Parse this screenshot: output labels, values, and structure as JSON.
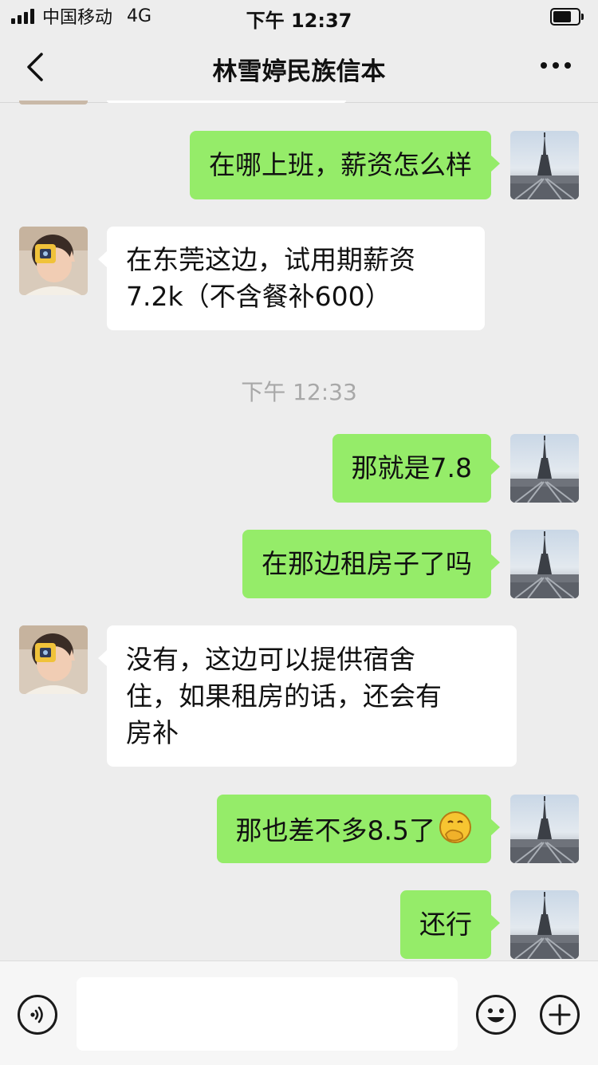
{
  "status_bar": {
    "carrier": "中国移动",
    "network": "4G",
    "time": "下午 12:37",
    "icons": [
      "signal-icon",
      "battery-icon"
    ]
  },
  "nav": {
    "title": "林雪婷民族信本",
    "back_icon": "chevron-left-icon",
    "more_icon": "more-dots-icon"
  },
  "messages": [
    {
      "side": "right",
      "text": "在哪上班，薪资怎么样"
    },
    {
      "side": "left",
      "lines": [
        "在东莞这边，试用期薪资",
        "7.2k（不含餐补600）"
      ]
    },
    {
      "side": "timestamp",
      "text": "下午 12:33"
    },
    {
      "side": "right",
      "text": "那就是7.8"
    },
    {
      "side": "right",
      "text": "在那边租房子了吗"
    },
    {
      "side": "left",
      "lines": [
        "没有，这边可以提供宿舍",
        "住，如果租房的话，还会有",
        "房补"
      ]
    },
    {
      "side": "right",
      "text": "那也差不多8.5了",
      "emoji": "hand-over-mouth-emoji"
    },
    {
      "side": "right",
      "text": "还行"
    }
  ],
  "input_bar": {
    "voice_icon": "voice-icon",
    "emoji_icon": "smiley-icon",
    "plus_icon": "plus-icon",
    "text_value": ""
  },
  "colors": {
    "background": "#ededed",
    "my_bubble": "#95ec69",
    "their_bubble": "#ffffff",
    "timestamp_text": "#a8a8a8"
  }
}
